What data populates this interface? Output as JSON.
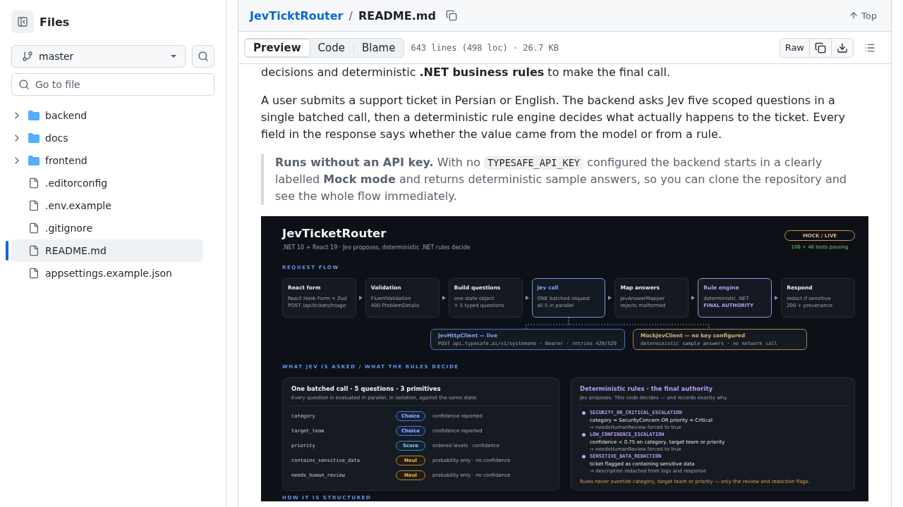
{
  "sidebar": {
    "title": "Files",
    "branch": "master",
    "search": {
      "placeholder": "Go to file"
    },
    "tree": [
      {
        "name": "backend",
        "kind": "folder",
        "expanded": false,
        "selected": false
      },
      {
        "name": "docs",
        "kind": "folder",
        "expanded": false,
        "selected": false
      },
      {
        "name": "frontend",
        "kind": "folder",
        "expanded": false,
        "selected": false
      },
      {
        "name": ".editorconfig",
        "kind": "file",
        "selected": false
      },
      {
        "name": ".env.example",
        "kind": "file",
        "selected": false
      },
      {
        "name": ".gitignore",
        "kind": "file",
        "selected": false
      },
      {
        "name": "README.md",
        "kind": "file",
        "selected": true
      },
      {
        "name": "appsettings.example.json",
        "kind": "file",
        "selected": false
      }
    ]
  },
  "breadcrumb": {
    "repo": "JevTicktRouter",
    "separator": "/",
    "file": "README.md"
  },
  "top_link": "Top",
  "view_tabs": [
    {
      "label": "Preview",
      "selected": true
    },
    {
      "label": "Code",
      "selected": false
    },
    {
      "label": "Blame",
      "selected": false
    }
  ],
  "file_info": "643 lines (498 loc) · 26.7 KB",
  "raw_button": "Raw",
  "readme": {
    "paragraphs": [
      "decisions and deterministic **.NET business rules** to make the final call.",
      "A user submits a support ticket in Persian or English. The backend asks Jev five scoped questions in a single batched call, then a deterministic rule engine decides what actually happens to the ticket. Every field in the response says whether the value came from the model or from a rule."
    ],
    "note": [
      {
        "kind": "text",
        "text": "**Runs without an API key.** With no "
      },
      {
        "kind": "code",
        "text": "TYPESAFE_API_KEY"
      },
      {
        "kind": "text",
        "text": " configured the backend starts in a clearly labelled **Mock mode** and returns deterministic sample answers, so you can clone the repository and see the whole flow immediately."
      }
    ]
  },
  "diagram": {
    "title": "JevTicketRouter",
    "subtitle": ".NET 10 + React 19 · Jev proposes, deterministic .NET rules decide",
    "mode_badge": "MOCK / LIVE",
    "tests": "106 + 46 tests passing",
    "flow_label": "REQUEST FLOW",
    "steps": [
      {
        "kind": "plain",
        "title": "React form",
        "lines": [
          "React Hook Form + Zod",
          "POST /api/tickets/triage"
        ]
      },
      {
        "kind": "plain",
        "title": "Validation",
        "lines": [
          "FluentValidation",
          "400 ProblemDetails"
        ]
      },
      {
        "kind": "plain",
        "title": "Build questions",
        "lines": [
          "one state object",
          "+ 5 typed questions"
        ]
      },
      {
        "kind": "model",
        "title": "Jev call",
        "lines": [
          "ONE batched request",
          "all 5 in parallel"
        ]
      },
      {
        "kind": "plain",
        "title": "Map answers",
        "lines": [
          "JevAnswerMapper",
          "rejects malformed"
        ]
      },
      {
        "kind": "authority",
        "title": "Rule engine",
        "lines": [
          "deterministic .NET",
          "**FINAL AUTHORITY**"
        ]
      },
      {
        "kind": "plain",
        "title": "Respond",
        "lines": [
          "redact if sensitive",
          "200 + provenance"
        ]
      }
    ],
    "clients": [
      {
        "kind": "live",
        "title": "JevHttpClient — live",
        "detail": "POST api.typesafe.ai/v1/systemone · Bearer · retries 429/529"
      },
      {
        "kind": "mock",
        "title": "MockJevClient — no key configured",
        "detail": "deterministic sample answers · no network call"
      }
    ],
    "questions_label": "WHAT JEV IS ASKED / WHAT THE RULES DECIDE",
    "questions_card": {
      "title": "One batched call · 5 questions · 3 primitives",
      "subtitle": "Every question is evaluated in parallel, in isolation, against the same state.",
      "rows": [
        {
          "name": "category",
          "kind": "choice",
          "primitive": "Choice",
          "note": "confidence reported"
        },
        {
          "name": "target_team",
          "kind": "choice",
          "primitive": "Choice",
          "note": "confidence reported"
        },
        {
          "name": "priority",
          "kind": "score",
          "primitive": "Score",
          "note": "ordered levels · confidence"
        },
        {
          "name": "contains_sensitive_data",
          "kind": "noul",
          "primitive": "Noul",
          "note": "probability only · no confidence"
        },
        {
          "name": "needs_human_review",
          "kind": "noul",
          "primitive": "Noul",
          "note": "probability only · no confidence"
        }
      ]
    },
    "rules_card": {
      "title": "Deterministic rules · the final authority",
      "subtitle": "Jev proposes. This code decides — and records exactly why.",
      "rules": [
        {
          "name": "SECURITY_OR_CRITICAL_ESCALATION",
          "condition": "category = SecurityConcern OR priority = Critical",
          "outcome": "⇒ needsHumanReview forced to true"
        },
        {
          "name": "LOW_CONFIDENCE_ESCALATION",
          "condition": "confidence < 0.75 on category, target team or priority",
          "outcome": "⇒ needsHumanReview forced to true"
        },
        {
          "name": "SENSITIVE_DATA_REDACTION",
          "condition": "ticket flagged as containing sensitive data",
          "outcome": "⇒ description redacted from logs and response"
        }
      ],
      "footer": "Rules never override category, target team or priority — only the review and redaction flags."
    },
    "structure_label": "HOW IT IS STRUCTURED"
  }
}
